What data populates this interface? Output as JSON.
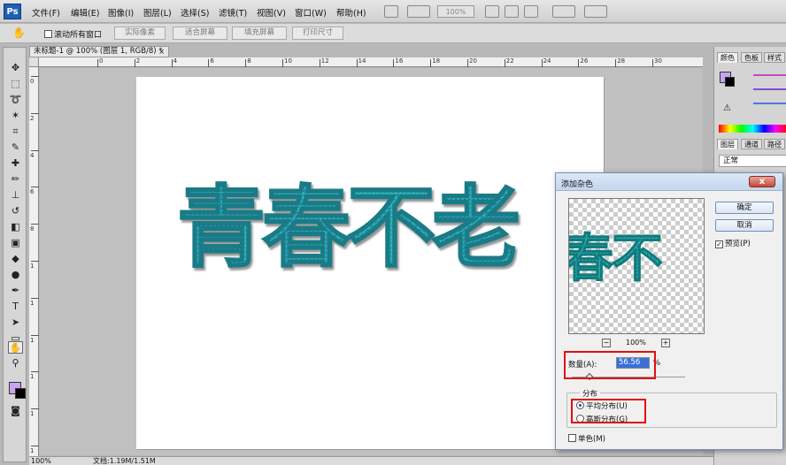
{
  "menubar": {
    "logo": "Ps",
    "items": [
      "文件(F)",
      "编辑(E)",
      "图像(I)",
      "图层(L)",
      "选择(S)",
      "滤镜(T)",
      "视图(V)",
      "窗口(W)",
      "帮助(H)"
    ],
    "zoom": "100%"
  },
  "options_bar": {
    "scroll_all_label": "滚动所有窗口",
    "buttons": [
      "实际像素",
      "适合屏幕",
      "填充屏幕",
      "打印尺寸"
    ]
  },
  "document": {
    "tab_title": "未标题-1 @ 100% (图层 1, RGB/8) *",
    "tab_close": "×",
    "canvas_text": "青春不老",
    "ruler_top": [
      "0",
      "2",
      "4",
      "6",
      "8",
      "10",
      "12",
      "14",
      "16",
      "18",
      "20",
      "22",
      "24",
      "26",
      "28",
      "30"
    ],
    "ruler_left": [
      "0",
      "2",
      "4",
      "6",
      "8",
      "1",
      "1",
      "1",
      "1",
      "1",
      "1",
      "2"
    ]
  },
  "panels": {
    "top_tabs": [
      "颜色",
      "色板",
      "样式"
    ],
    "layer_tabs": [
      "图层",
      "通道",
      "路径"
    ],
    "blend_mode": "正常"
  },
  "status": {
    "zoom": "100%",
    "doc_info": "文档:1.19M/1.51M"
  },
  "dialog": {
    "title": "添加杂色",
    "close": "x",
    "ok": "确定",
    "cancel": "取消",
    "preview_label": "预览(P)",
    "preview_checked": true,
    "preview_text": "春不",
    "zoom_minus": "−",
    "zoom_plus": "+",
    "zoom_percent": "100%",
    "amount_label": "数量(A):",
    "amount_value": "56.56",
    "amount_unit": "%",
    "distribution_label": "分布",
    "uniform_label": "平均分布(U)",
    "uniform_selected": true,
    "gaussian_label": "高斯分布(G)",
    "monochrome_label": "单色(M)",
    "monochrome_checked": false
  },
  "colors": {
    "foreground": "#c8a4f0",
    "background": "#000000",
    "highlight": "#e01010"
  }
}
